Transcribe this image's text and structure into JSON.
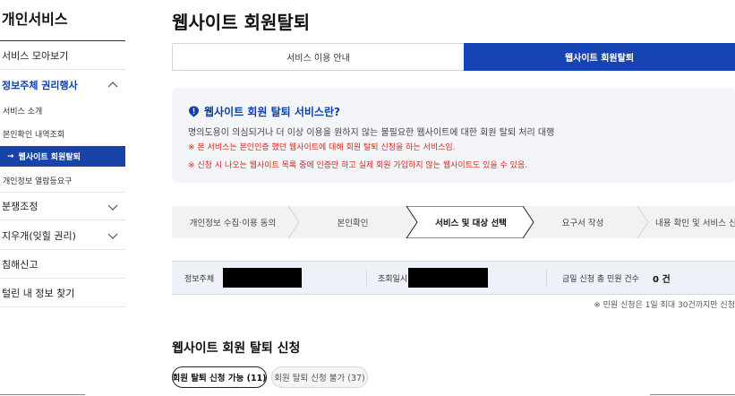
{
  "sidebar": {
    "title": "개인서비스",
    "items": [
      {
        "label": "서비스 모아보기"
      },
      {
        "label": "정보주체 권리행사"
      },
      {
        "label": "분쟁조정"
      },
      {
        "label": "지우개(잊힐 권리)"
      },
      {
        "label": "침해신고"
      },
      {
        "label": "털린 내 정보 찾기"
      }
    ],
    "sub_items": [
      {
        "label": "서비스 소개"
      },
      {
        "label": "본인확인 내역조회"
      },
      {
        "label": "웹사이트 회원탈퇴",
        "arrow": "→"
      },
      {
        "label": "개인정보 열람등요구"
      }
    ]
  },
  "page": {
    "title": "웹사이트 회원탈퇴"
  },
  "tabs": [
    {
      "label": "서비스 이용 안내"
    },
    {
      "label": "웹사이트 회원탈퇴"
    }
  ],
  "info": {
    "heading": "웹사이트 회원 탈퇴 서비스란?",
    "description": "명의도용이 의심되거나 더 이상 이용을 원하지 않는 불필요한 웹사이트에 대한 회원 탈퇴 처리 대행",
    "notes": [
      "※ 본 서비스는 본인인증 했던 웹사이트에 대해 회원 탈퇴 신청을 하는 서비스임.",
      "※ 신청 시 나오는 웹사이트 목록 중에 인증만 하고 실제 회원 가입하지 않는 웹사이트도 있을 수 있음."
    ]
  },
  "steps": [
    {
      "label": "개인정보 수집·이용 동의"
    },
    {
      "label": "본인확인"
    },
    {
      "label": "서비스 및 대상 선택"
    },
    {
      "label": "요구서 작성"
    },
    {
      "label": "내용 확인 및 서비스 신청"
    }
  ],
  "status": {
    "subject_label": "정보주체",
    "time_label": "조회일시",
    "count_label": "금일 신청 총 민원 건수",
    "count_value": "0 건"
  },
  "footnote": "※ 민원 신청은 1일 최대 30건까지만 신청",
  "section": {
    "title": "웹사이트 회원 탈퇴 신청",
    "filters": [
      {
        "label": "회원 탈퇴 신청 가능 (11)"
      },
      {
        "label": "회원 탈퇴 신청 불가 (37)"
      }
    ]
  },
  "colors": {
    "accent": "#1744b3",
    "warning": "#d8261c",
    "panel": "#f3f5f9"
  },
  "icons": {
    "chevron": "chevron-down-icon",
    "chevron_up": "chevron-up-icon",
    "info": "info-pin-icon"
  }
}
